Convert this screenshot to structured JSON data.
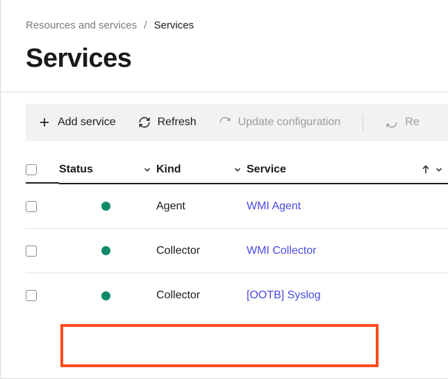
{
  "breadcrumb": {
    "root": "Resources and services",
    "current": "Services"
  },
  "page": {
    "title": "Services"
  },
  "toolbar": {
    "add_label": "Add service",
    "refresh_label": "Refresh",
    "update_label": "Update configuration",
    "restart_label_partial": "Re"
  },
  "columns": {
    "status": "Status",
    "kind": "Kind",
    "service": "Service"
  },
  "rows": [
    {
      "status": "up",
      "kind": "Agent",
      "service": "WMI Agent"
    },
    {
      "status": "up",
      "kind": "Collector",
      "service": "WMI Collector"
    },
    {
      "status": "up",
      "kind": "Collector",
      "service": "[OOTB] Syslog"
    }
  ],
  "highlight_row_index": 2,
  "colors": {
    "status_up": "#0e8a6b",
    "link": "#4a4ae6",
    "highlight": "#ff4a1a"
  }
}
